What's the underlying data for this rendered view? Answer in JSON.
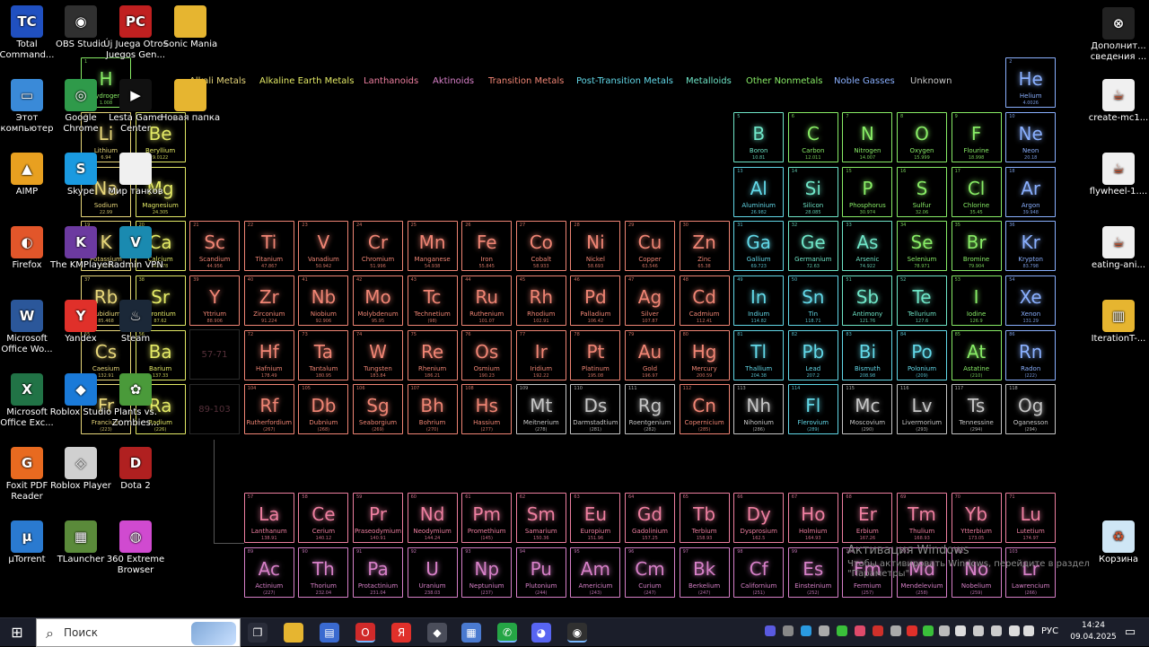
{
  "legend": [
    {
      "label": "Alkali Metals",
      "color": "#e8d77a"
    },
    {
      "label": "Alkaline Earth Metals",
      "color": "#e4ea66"
    },
    {
      "label": "Lanthanoids",
      "color": "#ee7fa0"
    },
    {
      "label": "Aktinoids",
      "color": "#d780c8"
    },
    {
      "label": "Transition Metals",
      "color": "#f08574"
    },
    {
      "label": "Post-Transition Metals",
      "color": "#62d8e8"
    },
    {
      "label": "Metalloids",
      "color": "#6fe6c8"
    },
    {
      "label": "Other Nonmetals",
      "color": "#88ec66"
    },
    {
      "label": "Noble Gasses",
      "color": "#8ab0ff"
    },
    {
      "label": "Unknown",
      "color": "#c6c6c6"
    }
  ],
  "placeholders": [
    "57-71",
    "89-103"
  ],
  "elements": [
    {
      "n": "1",
      "s": "H",
      "name": "Hydrogen",
      "m": "1.008",
      "c": "nonmetal"
    },
    {
      "n": "2",
      "s": "He",
      "name": "Helium",
      "m": "4.0026",
      "c": "noble"
    },
    {
      "n": "3",
      "s": "Li",
      "name": "Lithium",
      "m": "6.94",
      "c": "alkali"
    },
    {
      "n": "4",
      "s": "Be",
      "name": "Beryllium",
      "m": "9.0122",
      "c": "alkaline"
    },
    {
      "n": "5",
      "s": "B",
      "name": "Boron",
      "m": "10.81",
      "c": "metalloid"
    },
    {
      "n": "6",
      "s": "C",
      "name": "Carbon",
      "m": "12.011",
      "c": "nonmetal"
    },
    {
      "n": "7",
      "s": "N",
      "name": "Nitrogen",
      "m": "14.007",
      "c": "nonmetal"
    },
    {
      "n": "8",
      "s": "O",
      "name": "Oxygen",
      "m": "15.999",
      "c": "nonmetal"
    },
    {
      "n": "9",
      "s": "F",
      "name": "Flourine",
      "m": "18.998",
      "c": "nonmetal"
    },
    {
      "n": "10",
      "s": "Ne",
      "name": "Neon",
      "m": "20.18",
      "c": "noble"
    },
    {
      "n": "11",
      "s": "Na",
      "name": "Sodium",
      "m": "22.99",
      "c": "alkali"
    },
    {
      "n": "12",
      "s": "Mg",
      "name": "Magnesium",
      "m": "24.305",
      "c": "alkaline"
    },
    {
      "n": "13",
      "s": "Al",
      "name": "Aluminium",
      "m": "26.982",
      "c": "post"
    },
    {
      "n": "14",
      "s": "Si",
      "name": "Silicon",
      "m": "28.085",
      "c": "metalloid"
    },
    {
      "n": "15",
      "s": "P",
      "name": "Phosphorus",
      "m": "30.974",
      "c": "nonmetal"
    },
    {
      "n": "16",
      "s": "S",
      "name": "Sulfur",
      "m": "32.06",
      "c": "nonmetal"
    },
    {
      "n": "17",
      "s": "Cl",
      "name": "Chlorine",
      "m": "35.45",
      "c": "nonmetal"
    },
    {
      "n": "18",
      "s": "Ar",
      "name": "Argon",
      "m": "39.948",
      "c": "noble"
    },
    {
      "n": "19",
      "s": "K",
      "name": "Potassium",
      "m": "39.098",
      "c": "alkali"
    },
    {
      "n": "20",
      "s": "Ca",
      "name": "Calcium",
      "m": "40.078",
      "c": "alkaline"
    },
    {
      "n": "21",
      "s": "Sc",
      "name": "Scandium",
      "m": "44.956",
      "c": "transition"
    },
    {
      "n": "22",
      "s": "Ti",
      "name": "Titanium",
      "m": "47.867",
      "c": "transition"
    },
    {
      "n": "23",
      "s": "V",
      "name": "Vanadium",
      "m": "50.942",
      "c": "transition"
    },
    {
      "n": "24",
      "s": "Cr",
      "name": "Chromium",
      "m": "51.996",
      "c": "transition"
    },
    {
      "n": "25",
      "s": "Mn",
      "name": "Manganese",
      "m": "54.938",
      "c": "transition"
    },
    {
      "n": "26",
      "s": "Fe",
      "name": "Iron",
      "m": "55.845",
      "c": "transition"
    },
    {
      "n": "27",
      "s": "Co",
      "name": "Cobalt",
      "m": "58.933",
      "c": "transition"
    },
    {
      "n": "28",
      "s": "Ni",
      "name": "Nickel",
      "m": "58.693",
      "c": "transition"
    },
    {
      "n": "29",
      "s": "Cu",
      "name": "Copper",
      "m": "63.546",
      "c": "transition"
    },
    {
      "n": "30",
      "s": "Zn",
      "name": "Zinc",
      "m": "65.38",
      "c": "transition"
    },
    {
      "n": "31",
      "s": "Ga",
      "name": "Gallium",
      "m": "69.723",
      "c": "post"
    },
    {
      "n": "32",
      "s": "Ge",
      "name": "Germanium",
      "m": "72.63",
      "c": "metalloid"
    },
    {
      "n": "33",
      "s": "As",
      "name": "Arsenic",
      "m": "74.922",
      "c": "metalloid"
    },
    {
      "n": "34",
      "s": "Se",
      "name": "Selenium",
      "m": "78.971",
      "c": "nonmetal"
    },
    {
      "n": "35",
      "s": "Br",
      "name": "Bromine",
      "m": "79.904",
      "c": "nonmetal"
    },
    {
      "n": "36",
      "s": "Kr",
      "name": "Krypton",
      "m": "83.798",
      "c": "noble"
    },
    {
      "n": "37",
      "s": "Rb",
      "name": "Rubidium",
      "m": "85.468",
      "c": "alkali"
    },
    {
      "n": "38",
      "s": "Sr",
      "name": "Strontium",
      "m": "87.62",
      "c": "alkaline"
    },
    {
      "n": "39",
      "s": "Y",
      "name": "Yttrium",
      "m": "88.906",
      "c": "transition"
    },
    {
      "n": "40",
      "s": "Zr",
      "name": "Zirconium",
      "m": "91.224",
      "c": "transition"
    },
    {
      "n": "41",
      "s": "Nb",
      "name": "Niobium",
      "m": "92.906",
      "c": "transition"
    },
    {
      "n": "42",
      "s": "Mo",
      "name": "Molybdenum",
      "m": "95.95",
      "c": "transition"
    },
    {
      "n": "43",
      "s": "Tc",
      "name": "Technetium",
      "m": "(98)",
      "c": "transition"
    },
    {
      "n": "44",
      "s": "Ru",
      "name": "Ruthenium",
      "m": "101.07",
      "c": "transition"
    },
    {
      "n": "45",
      "s": "Rh",
      "name": "Rhodium",
      "m": "102.91",
      "c": "transition"
    },
    {
      "n": "46",
      "s": "Pd",
      "name": "Palladium",
      "m": "106.42",
      "c": "transition"
    },
    {
      "n": "47",
      "s": "Ag",
      "name": "Silver",
      "m": "107.87",
      "c": "transition"
    },
    {
      "n": "48",
      "s": "Cd",
      "name": "Cadmium",
      "m": "112.41",
      "c": "transition"
    },
    {
      "n": "49",
      "s": "In",
      "name": "Indium",
      "m": "114.82",
      "c": "post"
    },
    {
      "n": "50",
      "s": "Sn",
      "name": "Tin",
      "m": "118.71",
      "c": "post"
    },
    {
      "n": "51",
      "s": "Sb",
      "name": "Antimony",
      "m": "121.76",
      "c": "metalloid"
    },
    {
      "n": "52",
      "s": "Te",
      "name": "Tellurium",
      "m": "127.6",
      "c": "metalloid"
    },
    {
      "n": "53",
      "s": "I",
      "name": "Iodine",
      "m": "126.9",
      "c": "nonmetal"
    },
    {
      "n": "54",
      "s": "Xe",
      "name": "Xenon",
      "m": "131.29",
      "c": "noble"
    },
    {
      "n": "55",
      "s": "Cs",
      "name": "Caesium",
      "m": "132.91",
      "c": "alkali"
    },
    {
      "n": "56",
      "s": "Ba",
      "name": "Barium",
      "m": "137.33",
      "c": "alkaline"
    },
    {
      "n": "72",
      "s": "Hf",
      "name": "Hafnium",
      "m": "178.49",
      "c": "transition"
    },
    {
      "n": "73",
      "s": "Ta",
      "name": "Tantalum",
      "m": "180.95",
      "c": "transition"
    },
    {
      "n": "74",
      "s": "W",
      "name": "Tungsten",
      "m": "183.84",
      "c": "transition"
    },
    {
      "n": "75",
      "s": "Re",
      "name": "Rhenium",
      "m": "186.21",
      "c": "transition"
    },
    {
      "n": "76",
      "s": "Os",
      "name": "Osmium",
      "m": "190.23",
      "c": "transition"
    },
    {
      "n": "77",
      "s": "Ir",
      "name": "Iridium",
      "m": "192.22",
      "c": "transition"
    },
    {
      "n": "78",
      "s": "Pt",
      "name": "Platinum",
      "m": "195.08",
      "c": "transition"
    },
    {
      "n": "79",
      "s": "Au",
      "name": "Gold",
      "m": "196.97",
      "c": "transition"
    },
    {
      "n": "80",
      "s": "Hg",
      "name": "Mercury",
      "m": "200.59",
      "c": "transition"
    },
    {
      "n": "81",
      "s": "Tl",
      "name": "Thallium",
      "m": "204.38",
      "c": "post"
    },
    {
      "n": "82",
      "s": "Pb",
      "name": "Lead",
      "m": "207.2",
      "c": "post"
    },
    {
      "n": "83",
      "s": "Bi",
      "name": "Bismuth",
      "m": "208.98",
      "c": "post"
    },
    {
      "n": "84",
      "s": "Po",
      "name": "Polonium",
      "m": "(209)",
      "c": "post"
    },
    {
      "n": "85",
      "s": "At",
      "name": "Astatine",
      "m": "(210)",
      "c": "nonmetal"
    },
    {
      "n": "86",
      "s": "Rn",
      "name": "Radon",
      "m": "(222)",
      "c": "noble"
    },
    {
      "n": "87",
      "s": "Fr",
      "name": "Francium",
      "m": "(223)",
      "c": "alkali"
    },
    {
      "n": "88",
      "s": "Ra",
      "name": "Radium",
      "m": "(226)",
      "c": "alkaline"
    },
    {
      "n": "104",
      "s": "Rf",
      "name": "Rutherfordium",
      "m": "(267)",
      "c": "transition"
    },
    {
      "n": "105",
      "s": "Db",
      "name": "Dubnium",
      "m": "(268)",
      "c": "transition"
    },
    {
      "n": "106",
      "s": "Sg",
      "name": "Seaborgium",
      "m": "(269)",
      "c": "transition"
    },
    {
      "n": "107",
      "s": "Bh",
      "name": "Bohrium",
      "m": "(270)",
      "c": "transition"
    },
    {
      "n": "108",
      "s": "Hs",
      "name": "Hassium",
      "m": "(277)",
      "c": "transition"
    },
    {
      "n": "109",
      "s": "Mt",
      "name": "Meitnerium",
      "m": "(278)",
      "c": "unknown"
    },
    {
      "n": "110",
      "s": "Ds",
      "name": "Darmstadtium",
      "m": "(281)",
      "c": "unknown"
    },
    {
      "n": "111",
      "s": "Rg",
      "name": "Roentgenium",
      "m": "(282)",
      "c": "unknown"
    },
    {
      "n": "112",
      "s": "Cn",
      "name": "Copernicium",
      "m": "(285)",
      "c": "transition"
    },
    {
      "n": "113",
      "s": "Nh",
      "name": "Nihonium",
      "m": "(286)",
      "c": "unknown"
    },
    {
      "n": "114",
      "s": "Fl",
      "name": "Flerovium",
      "m": "(289)",
      "c": "post"
    },
    {
      "n": "115",
      "s": "Mc",
      "name": "Moscovium",
      "m": "(290)",
      "c": "unknown"
    },
    {
      "n": "116",
      "s": "Lv",
      "name": "Livermorium",
      "m": "(293)",
      "c": "unknown"
    },
    {
      "n": "117",
      "s": "Ts",
      "name": "Tennessine",
      "m": "(294)",
      "c": "unknown"
    },
    {
      "n": "118",
      "s": "Og",
      "name": "Oganesson",
      "m": "(294)",
      "c": "unknown"
    },
    {
      "n": "57",
      "s": "La",
      "name": "Lanthanum",
      "m": "138.91",
      "c": "lanthanoid"
    },
    {
      "n": "58",
      "s": "Ce",
      "name": "Cerium",
      "m": "140.12",
      "c": "lanthanoid"
    },
    {
      "n": "59",
      "s": "Pr",
      "name": "Praseodymium",
      "m": "140.91",
      "c": "lanthanoid"
    },
    {
      "n": "60",
      "s": "Nd",
      "name": "Neodymium",
      "m": "144.24",
      "c": "lanthanoid"
    },
    {
      "n": "61",
      "s": "Pm",
      "name": "Promethium",
      "m": "(145)",
      "c": "lanthanoid"
    },
    {
      "n": "62",
      "s": "Sm",
      "name": "Samarium",
      "m": "150.36",
      "c": "lanthanoid"
    },
    {
      "n": "63",
      "s": "Eu",
      "name": "Europium",
      "m": "151.96",
      "c": "lanthanoid"
    },
    {
      "n": "64",
      "s": "Gd",
      "name": "Gadolinium",
      "m": "157.25",
      "c": "lanthanoid"
    },
    {
      "n": "65",
      "s": "Tb",
      "name": "Terbium",
      "m": "158.93",
      "c": "lanthanoid"
    },
    {
      "n": "66",
      "s": "Dy",
      "name": "Dysprosium",
      "m": "162.5",
      "c": "lanthanoid"
    },
    {
      "n": "67",
      "s": "Ho",
      "name": "Holmium",
      "m": "164.93",
      "c": "lanthanoid"
    },
    {
      "n": "68",
      "s": "Er",
      "name": "Erbium",
      "m": "167.26",
      "c": "lanthanoid"
    },
    {
      "n": "69",
      "s": "Tm",
      "name": "Thulium",
      "m": "168.93",
      "c": "lanthanoid"
    },
    {
      "n": "70",
      "s": "Yb",
      "name": "Ytterbium",
      "m": "173.05",
      "c": "lanthanoid"
    },
    {
      "n": "71",
      "s": "Lu",
      "name": "Lutetium",
      "m": "174.97",
      "c": "lanthanoid"
    },
    {
      "n": "89",
      "s": "Ac",
      "name": "Actinium",
      "m": "(227)",
      "c": "aktinoid"
    },
    {
      "n": "90",
      "s": "Th",
      "name": "Thorium",
      "m": "232.04",
      "c": "aktinoid"
    },
    {
      "n": "91",
      "s": "Pa",
      "name": "Protactinium",
      "m": "231.04",
      "c": "aktinoid"
    },
    {
      "n": "92",
      "s": "U",
      "name": "Uranium",
      "m": "238.03",
      "c": "aktinoid"
    },
    {
      "n": "93",
      "s": "Np",
      "name": "Neptunium",
      "m": "(237)",
      "c": "aktinoid"
    },
    {
      "n": "94",
      "s": "Pu",
      "name": "Plutonium",
      "m": "(244)",
      "c": "aktinoid"
    },
    {
      "n": "95",
      "s": "Am",
      "name": "Americium",
      "m": "(243)",
      "c": "aktinoid"
    },
    {
      "n": "96",
      "s": "Cm",
      "name": "Curium",
      "m": "(247)",
      "c": "aktinoid"
    },
    {
      "n": "97",
      "s": "Bk",
      "name": "Berkelium",
      "m": "(247)",
      "c": "aktinoid"
    },
    {
      "n": "98",
      "s": "Cf",
      "name": "Californium",
      "m": "(251)",
      "c": "aktinoid"
    },
    {
      "n": "99",
      "s": "Es",
      "name": "Einsteinium",
      "m": "(252)",
      "c": "aktinoid"
    },
    {
      "n": "100",
      "s": "Fm",
      "name": "Fermium",
      "m": "(257)",
      "c": "aktinoid"
    },
    {
      "n": "101",
      "s": "Md",
      "name": "Mendelevium",
      "m": "(258)",
      "c": "aktinoid"
    },
    {
      "n": "102",
      "s": "No",
      "name": "Nobelium",
      "m": "(259)",
      "c": "aktinoid"
    },
    {
      "n": "103",
      "s": "Lr",
      "name": "Lawrencium",
      "m": "(266)",
      "c": "aktinoid"
    }
  ],
  "colors": {
    "alkali": "#e8d77a",
    "alkaline": "#e4ea66",
    "lanthanoid": "#ee7fa0",
    "aktinoid": "#d780c8",
    "transition": "#f08574",
    "post": "#62d8e8",
    "metalloid": "#6fe6c8",
    "nonmetal": "#88ec66",
    "noble": "#8ab0ff",
    "unknown": "#c6c6c6"
  },
  "desktop_icons": [
    {
      "label": "Total Command...",
      "icon": "floppy-icon",
      "bg": "#2050c0",
      "g": "TC"
    },
    {
      "label": "OBS Studio",
      "icon": "obs-icon",
      "bg": "#303030",
      "g": "◉"
    },
    {
      "label": "Új Juega Otros Juegos Gen...",
      "icon": "popcap-icon",
      "bg": "#c02020",
      "g": "PC"
    },
    {
      "label": "Sonic Mania",
      "icon": "folder-icon",
      "bg": "#e6b530",
      "g": ""
    },
    {
      "label": "Этот компьютер",
      "icon": "computer-icon",
      "bg": "#3a8ad8",
      "g": "▭"
    },
    {
      "label": "Google Chrome",
      "icon": "chrome-icon",
      "bg": "#2f9a4a",
      "g": "◎"
    },
    {
      "label": "Lesta Game Center",
      "icon": "lesta-icon",
      "bg": "#111111",
      "g": "▶"
    },
    {
      "label": "Новая папка",
      "icon": "folder-icon",
      "bg": "#e6b530",
      "g": ""
    },
    {
      "label": "AIMP",
      "icon": "aimp-icon",
      "bg": "#e8a020",
      "g": "▲"
    },
    {
      "label": "Skype",
      "icon": "skype-icon",
      "bg": "#1a9ae0",
      "g": "S"
    },
    {
      "label": "Мир танков",
      "icon": "file-icon",
      "bg": "#f0f0f0",
      "g": ""
    },
    {
      "label": "Firefox",
      "icon": "firefox-icon",
      "bg": "#e2562a",
      "g": "◐"
    },
    {
      "label": "The KMPlayer",
      "icon": "kmplayer-icon",
      "bg": "#6c3aa0",
      "g": "K"
    },
    {
      "label": "Radmin VPN",
      "icon": "radmin-icon",
      "bg": "#1a8ab0",
      "g": "V"
    },
    {
      "label": "Microsoft Office Wo...",
      "icon": "word-icon",
      "bg": "#2b579a",
      "g": "W"
    },
    {
      "label": "Yandex",
      "icon": "yandex-icon",
      "bg": "#e0302a",
      "g": "Y"
    },
    {
      "label": "Steam",
      "icon": "steam-icon",
      "bg": "#1b2838",
      "g": "♨"
    },
    {
      "label": "Microsoft Office Exc...",
      "icon": "excel-icon",
      "bg": "#217346",
      "g": "X"
    },
    {
      "label": "Roblox Studio",
      "icon": "roblox-studio-icon",
      "bg": "#1a7ad8",
      "g": "◆"
    },
    {
      "label": "Plants vs. Zombies...",
      "icon": "plants-icon",
      "bg": "#4a9a3a",
      "g": "✿"
    },
    {
      "label": "Foxit PDF Reader",
      "icon": "foxit-icon",
      "bg": "#e86a20",
      "g": "G"
    },
    {
      "label": "Roblox Player",
      "icon": "roblox-icon",
      "bg": "#d0d0d0",
      "g": "◇"
    },
    {
      "label": "Dota 2",
      "icon": "dota-icon",
      "bg": "#b02020",
      "g": "D"
    },
    {
      "label": "µTorrent",
      "icon": "utorrent-icon",
      "bg": "#2a7ad0",
      "g": "µ"
    },
    {
      "label": "TLauncher",
      "icon": "tlauncher-icon",
      "bg": "#5a8a3a",
      "g": "▦"
    },
    {
      "label": "360 Extreme Browser",
      "icon": "360-icon",
      "bg": "#d04ad0",
      "g": "◍"
    }
  ],
  "right_icons": [
    {
      "label": "Дополнит... сведения ...",
      "icon": "gear-icon",
      "bg": "#222222",
      "g": "⊗"
    },
    {
      "label": "create-mc1...",
      "icon": "java-icon",
      "bg": "#f0f0f0",
      "g": "☕"
    },
    {
      "label": "flywheel-1....",
      "icon": "java-icon",
      "bg": "#f0f0f0",
      "g": "☕"
    },
    {
      "label": "eating-ani...",
      "icon": "java-icon",
      "bg": "#f0f0f0",
      "g": "☕"
    },
    {
      "label": "IterationT-...",
      "icon": "zip-icon",
      "bg": "#e6b530",
      "g": "▥"
    },
    {
      "label": "Корзина",
      "icon": "recycle-bin-icon",
      "bg": "#cfe6f5",
      "g": "♻"
    }
  ],
  "watermark": {
    "title": "Активация Windows",
    "line": "Чтобы активировать Windows, перейдите в раздел \"Параметры\"."
  },
  "taskbar": {
    "search_placeholder": "Поиск",
    "language": "РУС",
    "time": "14:24",
    "date": "09.04.2025"
  }
}
